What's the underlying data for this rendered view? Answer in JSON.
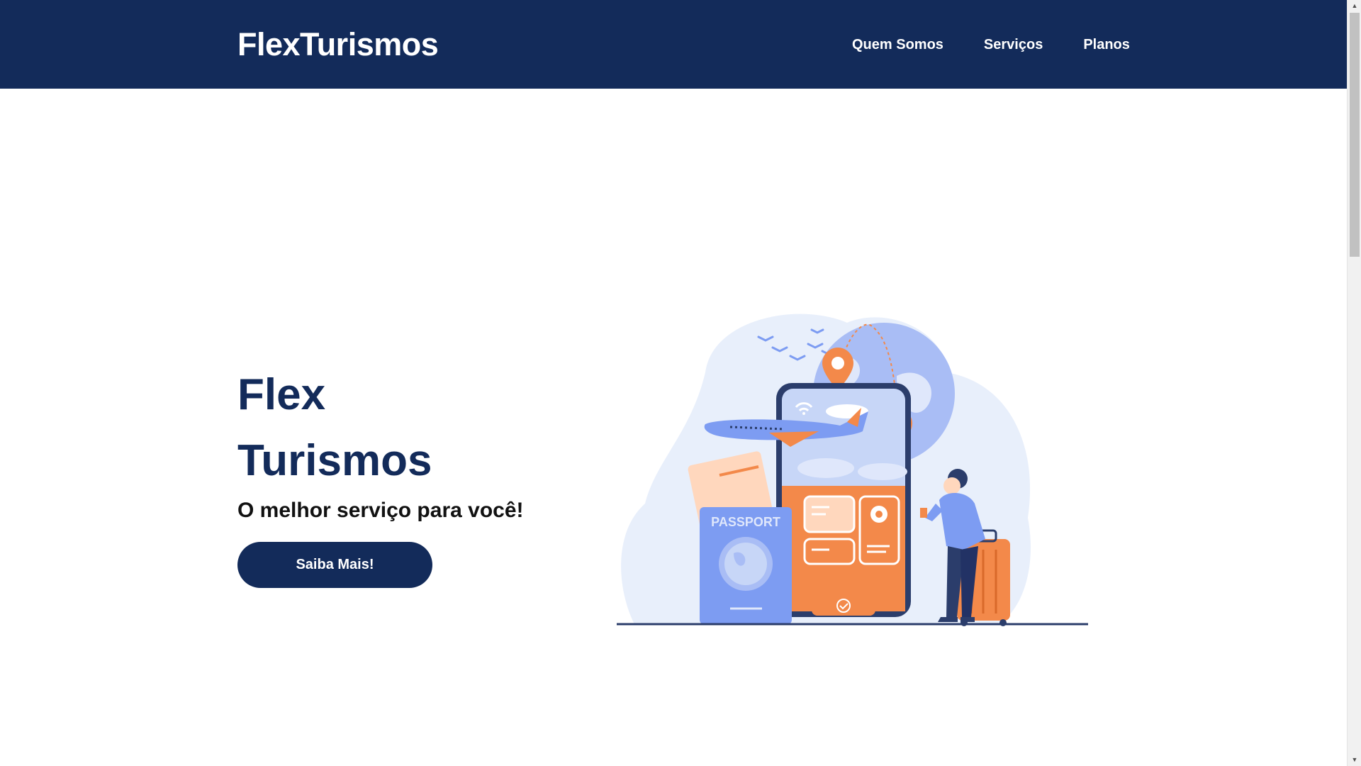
{
  "header": {
    "brand": "FlexTurismos",
    "nav": [
      {
        "label": "Quem Somos"
      },
      {
        "label": "Serviços"
      },
      {
        "label": "Planos"
      }
    ]
  },
  "hero": {
    "title_line1": "Flex",
    "title_line2": "Turismos",
    "subtitle": "O melhor serviço para você!",
    "cta_label": "Saiba Mais!",
    "illustration": {
      "passport_text": "PASSPORT",
      "description_icon": "travel-illustration"
    }
  },
  "colors": {
    "primary": "#132b5a",
    "accent_orange": "#f3894a",
    "accent_blue": "#7d9cf2",
    "light_blue": "#e8effb"
  }
}
